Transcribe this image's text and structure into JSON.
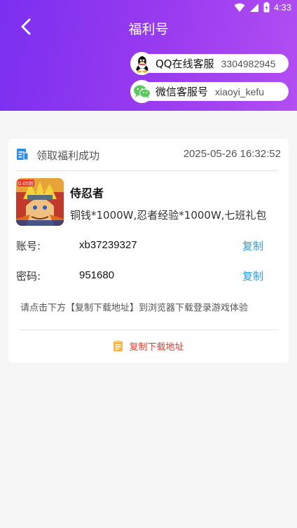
{
  "status_bar": {
    "time": "4:33"
  },
  "header": {
    "title": "福利号"
  },
  "contacts": {
    "qq": {
      "label": "QQ在线客服",
      "value": "3304982945"
    },
    "wechat": {
      "label": "微信客服号",
      "value": "xiaoyi_kefu"
    }
  },
  "card": {
    "header_label": "领取福利成功",
    "timestamp": "2025-05-26 16:32:52",
    "game": {
      "name": "侍忍者",
      "description": "铜钱*1000W,忍者经验*1000W,七班礼包",
      "icon_badge": "0.05折"
    },
    "account": {
      "label": "账号:",
      "value": "xb37239327",
      "copy": "复制"
    },
    "password": {
      "label": "密码:",
      "value": "951680",
      "copy": "复制"
    },
    "hint": "请点击下方【复制下载地址】到浏览器下载登录游戏体验",
    "download_button": "复制下载地址"
  },
  "colors": {
    "header_start": "#7b2ff0",
    "header_end": "#b24ef2",
    "link": "#2a9dd6",
    "download": "#e53a2b"
  }
}
